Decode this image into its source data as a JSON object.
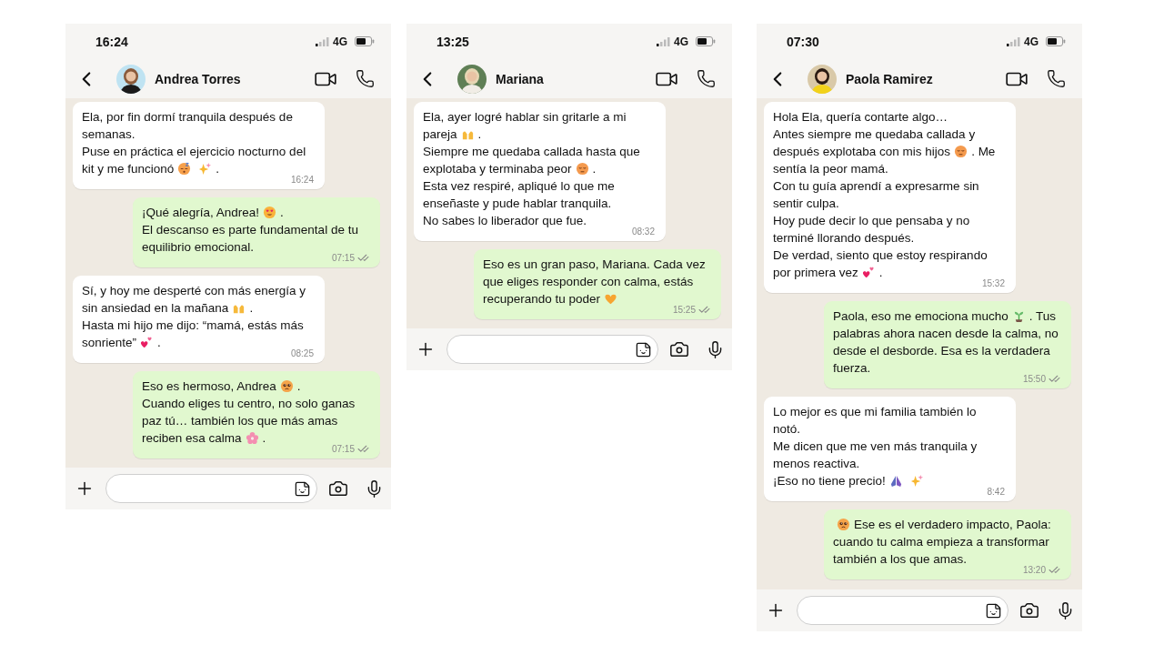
{
  "chats": [
    {
      "status": {
        "time": "16:24",
        "network": "4G"
      },
      "contact": {
        "name": "Andrea Torres"
      },
      "messages": [
        {
          "kind": "incoming",
          "time": "16:24",
          "lines": [
            [
              "Ela, por fin dormí tranquila después de"
            ],
            [
              "semanas."
            ],
            [
              "Puse en práctica el ejercicio nocturno del"
            ],
            [
              "kit y me funcionó",
              {
                "kind": "sleeping"
              },
              {
                "kind": "sparkles"
              },
              "."
            ]
          ]
        },
        {
          "kind": "outgoing",
          "time": "07:15",
          "lines": [
            [
              "¡Qué alegría, Andrea!",
              {
                "kind": "hearteyes"
              },
              "."
            ],
            [
              "El descanso es parte fundamental de tu"
            ],
            [
              "equilibrio emocional."
            ]
          ]
        },
        {
          "kind": "incoming",
          "time": "08:25",
          "lines": [
            [
              "Sí, y hoy me desperté con más energía y"
            ],
            [
              "sin ansiedad en la mañana",
              {
                "kind": "hands"
              },
              "."
            ],
            [
              "Hasta mi hijo me dijo: “mamá, estás más"
            ],
            [
              "sonriente”",
              {
                "kind": "hearts"
              },
              "."
            ]
          ]
        },
        {
          "kind": "outgoing",
          "time": "07:15",
          "lines": [
            [
              "Eso es hermoso, Andrea",
              {
                "kind": "pleading"
              },
              "."
            ],
            [
              "Cuando eliges tu centro, no solo ganas"
            ],
            [
              "paz tú… también los que más amas"
            ],
            [
              "reciben esa calma",
              {
                "kind": "blossom"
              },
              "."
            ]
          ]
        }
      ]
    },
    {
      "status": {
        "time": "13:25",
        "network": "4G"
      },
      "contact": {
        "name": "Mariana"
      },
      "messages": [
        {
          "kind": "incoming",
          "time": "08:32",
          "lines": [
            [
              "Ela, ayer logré hablar sin gritarle a mi"
            ],
            [
              "pareja",
              {
                "kind": "hands"
              },
              "."
            ],
            [
              "Siempre me quedaba callada hasta que"
            ],
            [
              "explotaba y terminaba peor",
              {
                "kind": "pensive"
              },
              "."
            ],
            [
              "Esta vez respiré, apliqué lo que me"
            ],
            [
              "enseñaste y pude hablar tranquila."
            ],
            [
              "No sabes lo liberador que fue."
            ]
          ]
        },
        {
          "kind": "outgoing",
          "time": "15:25",
          "lines": [
            [
              "Eso es un gran paso, Mariana. Cada vez"
            ],
            [
              "que eliges responder con calma, estás"
            ],
            [
              "recuperando tu poder",
              {
                "kind": "heart"
              }
            ]
          ]
        }
      ]
    },
    {
      "status": {
        "time": "07:30",
        "network": "4G"
      },
      "contact": {
        "name": "Paola Ramirez"
      },
      "messages": [
        {
          "kind": "incoming",
          "time": "15:32",
          "lines": [
            [
              "Hola Ela, quería contarte algo…"
            ],
            [
              "Antes siempre me quedaba callada y"
            ],
            [
              "después explotaba con mis hijos",
              {
                "kind": "pensive"
              },
              ". Me"
            ],
            [
              "sentía la peor mamá."
            ],
            [
              "Con tu guía aprendí a expresarme sin"
            ],
            [
              "sentir culpa."
            ],
            [
              "Hoy pude decir lo que pensaba y no"
            ],
            [
              "terminé llorando después."
            ],
            [
              "De verdad, siento que estoy respirando"
            ],
            [
              "por primera vez",
              {
                "kind": "hearts"
              },
              "."
            ]
          ]
        },
        {
          "kind": "outgoing",
          "time": "15:50",
          "lines": [
            [
              "Paola, eso me emociona mucho",
              {
                "kind": "seedling"
              },
              ". Tus"
            ],
            [
              "palabras ahora nacen desde la calma, no"
            ],
            [
              "desde el desborde. Esa es la verdadera"
            ],
            [
              "fuerza."
            ]
          ]
        },
        {
          "kind": "incoming",
          "time": "8:42",
          "lines": [
            [
              "Lo mejor es que mi familia también lo"
            ],
            [
              "notó."
            ],
            [
              "Me dicen que me ven más tranquila y"
            ],
            [
              "menos reactiva."
            ],
            [
              "¡Eso no tiene precio!",
              {
                "kind": "pray"
              },
              {
                "kind": "sparkles"
              }
            ]
          ]
        },
        {
          "kind": "outgoing",
          "time": "13:20",
          "lines": [
            [
              {
                "kind": "pleading"
              },
              "Ese es el verdadero impacto, Paola:"
            ],
            [
              "cuando tu calma empieza a transformar"
            ],
            [
              "también a los que amas."
            ]
          ]
        }
      ]
    }
  ]
}
